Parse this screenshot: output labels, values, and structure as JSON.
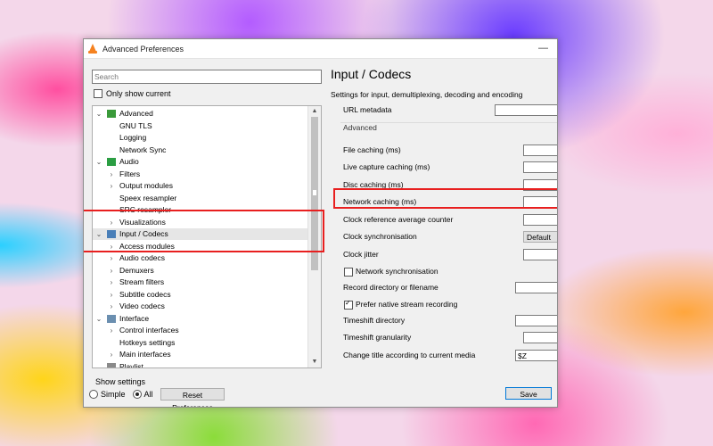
{
  "window": {
    "title": "Advanced Preferences",
    "minimize_glyph": "—"
  },
  "left": {
    "search_placeholder": "Search",
    "only_show_current": "Only show current",
    "tree": [
      {
        "label": "Advanced",
        "arrow": "⌄",
        "icon": "advanced-icon"
      },
      {
        "label": "GNU TLS",
        "arrow": ""
      },
      {
        "label": "Logging",
        "arrow": ""
      },
      {
        "label": "Network Sync",
        "arrow": ""
      },
      {
        "label": "Audio",
        "arrow": "⌄",
        "icon": "audio-icon"
      },
      {
        "label": "Filters",
        "arrow": "›"
      },
      {
        "label": "Output modules",
        "arrow": "›"
      },
      {
        "label": "Speex resampler",
        "arrow": ""
      },
      {
        "label": "SRC resampler",
        "arrow": ""
      },
      {
        "label": "Visualizations",
        "arrow": "›"
      },
      {
        "label": "Input / Codecs",
        "arrow": "⌄",
        "icon": "input-codecs-icon",
        "selected": true
      },
      {
        "label": "Access modules",
        "arrow": "›"
      },
      {
        "label": "Audio codecs",
        "arrow": "›"
      },
      {
        "label": "Demuxers",
        "arrow": "›"
      },
      {
        "label": "Stream filters",
        "arrow": "›"
      },
      {
        "label": "Subtitle codecs",
        "arrow": "›"
      },
      {
        "label": "Video codecs",
        "arrow": "›"
      },
      {
        "label": "Interface",
        "arrow": "⌄",
        "icon": "interface-icon"
      },
      {
        "label": "Control interfaces",
        "arrow": "›"
      },
      {
        "label": "Hotkeys settings",
        "arrow": ""
      },
      {
        "label": "Main interfaces",
        "arrow": "›"
      },
      {
        "label": "Playlist",
        "arrow": "⌄",
        "icon": "playlist-icon"
      }
    ],
    "show_settings": "Show settings",
    "simple": "Simple",
    "all": "All",
    "reset": "Reset Preferences"
  },
  "right": {
    "title": "Input / Codecs",
    "description": "Settings for input, demultiplexing, decoding and encoding",
    "url_metadata": "URL metadata",
    "advanced_group": "Advanced",
    "fields": [
      {
        "label": "File caching (ms)",
        "value": ""
      },
      {
        "label": "Live capture caching (ms)",
        "value": ""
      },
      {
        "label": "Disc caching (ms)",
        "value": ""
      },
      {
        "label": "Network caching (ms)",
        "value": ""
      },
      {
        "label": "Clock reference average counter",
        "value": ""
      },
      {
        "label": "Clock synchronisation",
        "value": "Default"
      },
      {
        "label": "Clock jitter",
        "value": ""
      },
      {
        "label": "Network synchronisation",
        "checked": false
      },
      {
        "label": "Record directory or filename",
        "value": ""
      },
      {
        "label": "Prefer native stream recording",
        "checked": true
      },
      {
        "label": "Timeshift directory",
        "value": ""
      },
      {
        "label": "Timeshift granularity",
        "value": ""
      },
      {
        "label": "Change title according to current media",
        "value": "$Z"
      }
    ],
    "save": "Save"
  },
  "colors": {
    "highlight": "#e81f1f",
    "vlc_orange": "#f58220"
  }
}
